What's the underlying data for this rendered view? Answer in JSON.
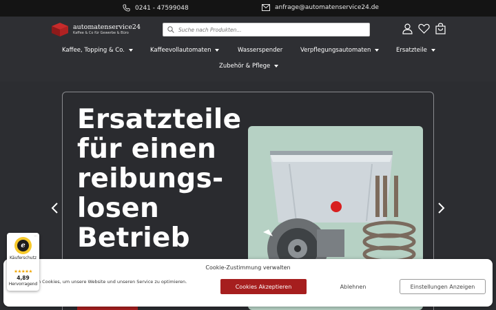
{
  "topbar": {
    "phone": "0241 - 47599048",
    "email": "anfrage@automatenservice24.de",
    "phone_icon": "phone-icon",
    "mail_icon": "mail-icon"
  },
  "logo": {
    "name": "automatenservice24",
    "tagline": "Kaffee & Co für Gewerbe & Büro",
    "brand_color": "#a61e1e"
  },
  "search": {
    "placeholder": "Suche nach Produkten...",
    "icon": "search-icon"
  },
  "header_icons": [
    "user-icon",
    "heart-icon",
    "cart-icon"
  ],
  "nav": {
    "items": [
      {
        "label": "Kaffee, Topping & Co.",
        "has_dropdown": true
      },
      {
        "label": "Kaffeevollautomaten",
        "has_dropdown": true
      },
      {
        "label": "Wasserspender",
        "has_dropdown": false
      },
      {
        "label": "Verpflegungsautomaten",
        "has_dropdown": true
      },
      {
        "label": "Ersatzteile",
        "has_dropdown": true
      },
      {
        "label": "Zubehör & Pflege",
        "has_dropdown": true
      }
    ]
  },
  "hero": {
    "headline": "Ersatzteile für einen reibungs-losen Betrieb",
    "prev_icon": "chevron-left-icon",
    "next_icon": "chevron-right-icon"
  },
  "cookie": {
    "title": "Cookie-Zustimmung verwalten",
    "text": "n Cookies, um unsere Website und unseren Service zu optimieren.",
    "accept": "Cookies Akzeptieren",
    "deny": "Ablehnen",
    "settings": "Einstellungen Anzeigen"
  },
  "trust_badge": {
    "label": "Käuferschutz",
    "stars": "★★★★★",
    "score": "4,89",
    "rating": "Hervorragend",
    "more": "..."
  },
  "colors": {
    "accent": "#a61e1e",
    "header_bg": "#2e2f33",
    "topbar_bg": "#141414",
    "hero_image_bg": "#b6d1c4"
  }
}
